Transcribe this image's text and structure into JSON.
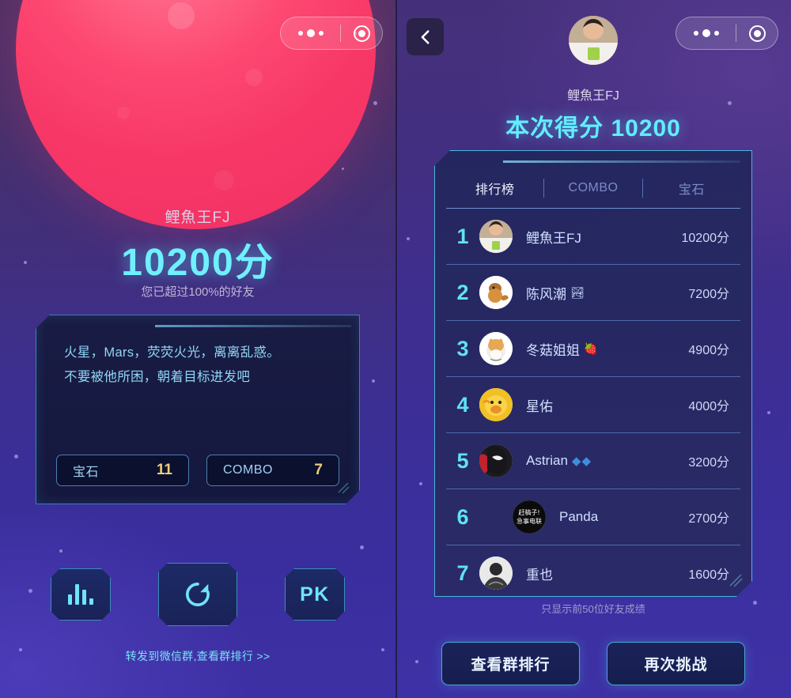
{
  "colors": {
    "accent_cyan": "#6ff0ff",
    "gold": "#f0cd76",
    "planet_pink": "#fd4872",
    "panel_border": "#4ab6d8"
  },
  "left_panel": {
    "capsule": {
      "more_icon": "more-dots-icon",
      "target_icon": "target-icon"
    },
    "planet_icon": "mars-planet",
    "player_name": "鲤魚王FJ",
    "score_text": "10200分",
    "subtitle": "您已超过100%的好友",
    "message": {
      "line1": "火星，Mars，荧荧火光，离离乱惑。",
      "line2": "不要被他所困，朝着目标进发吧"
    },
    "stats": [
      {
        "label": "宝石",
        "value": "11"
      },
      {
        "label": "COMBO",
        "value": "7"
      }
    ],
    "actions": [
      {
        "name": "rank-button",
        "icon": "bar-chart-icon",
        "label": ""
      },
      {
        "name": "replay-button",
        "icon": "refresh-icon",
        "label": ""
      },
      {
        "name": "pk-button",
        "icon": "",
        "label": "PK"
      }
    ],
    "share_link": "转发到微信群,查看群排行 >>"
  },
  "right_panel": {
    "back_icon": "chevron-left-icon",
    "capsule": {
      "more_icon": "more-dots-icon",
      "target_icon": "target-icon"
    },
    "avatar": "user-avatar",
    "player_name": "鲤魚王FJ",
    "score_headline": "本次得分 10200",
    "tabs": [
      {
        "label": "排行榜",
        "active": true
      },
      {
        "label": "COMBO",
        "active": false
      },
      {
        "label": "宝石",
        "active": false
      }
    ],
    "rows": [
      {
        "rank": "1",
        "name": "鲤魚王FJ",
        "badge": "",
        "score": "10200分",
        "avatar": "photo-person"
      },
      {
        "rank": "2",
        "name": "陈风潮",
        "badge": "🏞",
        "score": "7200分",
        "avatar": "cartoon-fish"
      },
      {
        "rank": "3",
        "name": "冬菇姐姐",
        "badge": "🍓",
        "score": "4900分",
        "avatar": "cartoon-corgi"
      },
      {
        "rank": "4",
        "name": "星佑",
        "badge": "",
        "score": "4000分",
        "avatar": "cartoon-duck"
      },
      {
        "rank": "5",
        "name": "Astrian",
        "badge": "◆◆",
        "score": "3200分",
        "avatar": "anime-character"
      },
      {
        "rank": "6",
        "name": "Panda",
        "badge": "",
        "score": "2700分",
        "avatar": "text-avatar-black"
      },
      {
        "rank": "7",
        "name": "重也",
        "badge": "",
        "score": "1600分",
        "avatar": "photo-bw"
      }
    ],
    "note": "只显示前50位好友成绩",
    "buttons": [
      {
        "name": "view-group-rank-button",
        "label": "查看群排行"
      },
      {
        "name": "challenge-again-button",
        "label": "再次挑战"
      }
    ]
  }
}
